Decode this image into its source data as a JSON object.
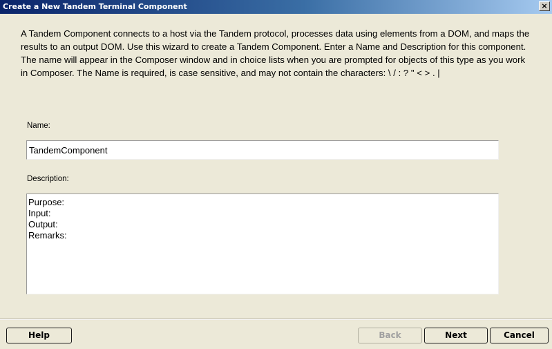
{
  "window": {
    "title": "Create a New Tandem Terminal Component",
    "close_label": "×"
  },
  "intro_text": "A Tandem Component connects to a host via the Tandem protocol, processes data using elements from a DOM, and maps the results to an output DOM.  Use this wizard to create a Tandem Component.  Enter a Name and Description for this component.  The name will appear in the Composer window and in choice lists when you are prompted for objects of this type as you work in Composer.  The Name is required, is case sensitive, and may not contain the characters: \\ / : ? \" < > . |",
  "name_field": {
    "label": "Name:",
    "value": "TandemComponent"
  },
  "description_field": {
    "label": "Description:",
    "value": "Purpose:\nInput:\nOutput:\nRemarks:"
  },
  "buttons": {
    "help": "Help",
    "back": "Back",
    "next": "Next",
    "cancel": "Cancel"
  },
  "colors": {
    "titlebar_start": "#0a246a",
    "titlebar_end": "#a6caf0",
    "dialog_background": "#ece9d8",
    "disabled_text": "#a0a0a0"
  }
}
